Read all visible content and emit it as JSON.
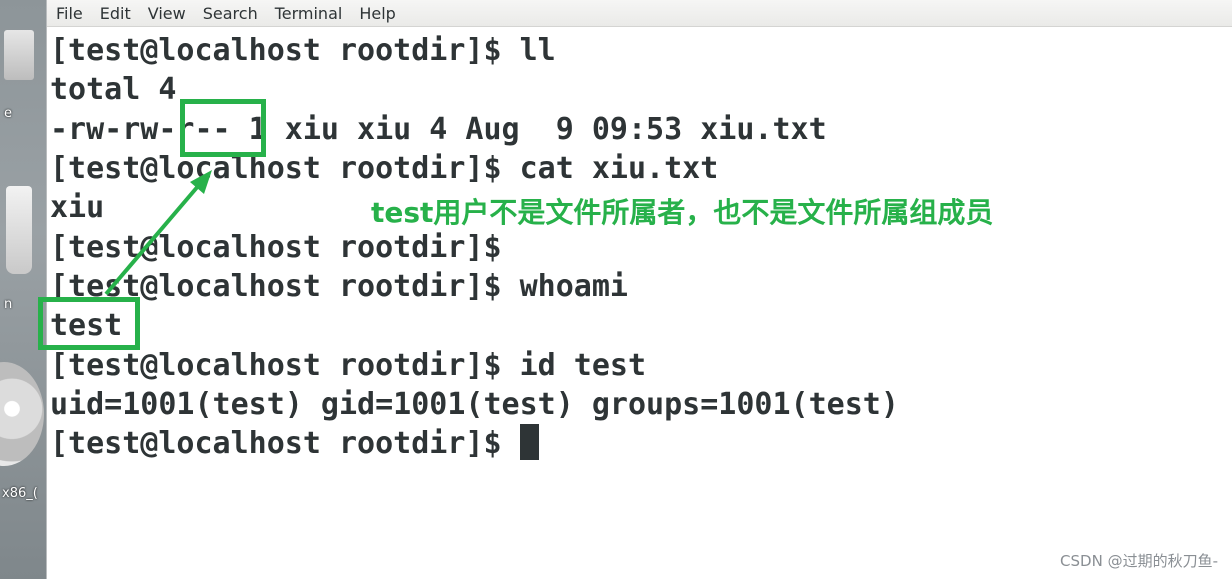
{
  "menubar": {
    "items": [
      "File",
      "Edit",
      "View",
      "Search",
      "Terminal",
      "Help"
    ]
  },
  "desktop": {
    "labels": [
      "e",
      "n",
      "x86_("
    ]
  },
  "terminal": {
    "lines": [
      "[test@localhost rootdir]$ ll",
      "total 4",
      "-rw-rw-r-- 1 xiu xiu 4 Aug  9 09:53 xiu.txt",
      "[test@localhost rootdir]$ cat xiu.txt",
      "xiu",
      "[test@localhost rootdir]$",
      "[test@localhost rootdir]$ whoami",
      "test",
      "[test@localhost rootdir]$ id test",
      "uid=1001(test) gid=1001(test) groups=1001(test)",
      "[test@localhost rootdir]$ "
    ]
  },
  "annotation": {
    "note": "test用户不是文件所属者，也不是文件所属组成员",
    "color": "#27b14a"
  },
  "watermark": "CSDN @过期的秋刀鱼-"
}
